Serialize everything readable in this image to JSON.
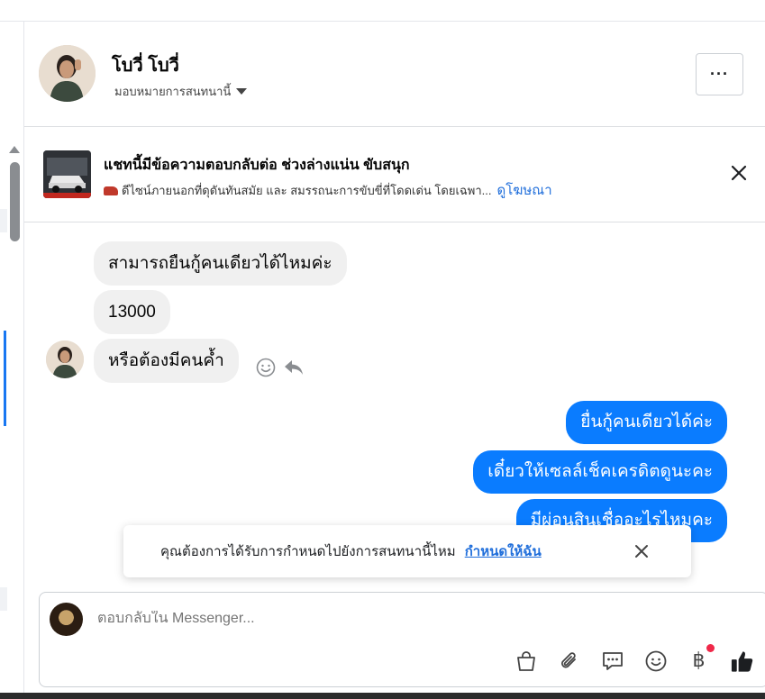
{
  "header": {
    "contact_name": "โบวี่ โบวี่",
    "assign_label": "มอบหมายการสนทนานี้",
    "more_label": "···"
  },
  "ad": {
    "title": "แชทนี้มีข้อความตอบกลับต่อ ช่วงล่างแน่น ขับสนุก",
    "subtitle": "ดีไซน์ภายนอกที่ดุดันทันสมัย และ สมรรถนะการขับขี่ที่โดดเด่น โดยเฉพา...",
    "link": "ดูโฆษณา"
  },
  "messages": {
    "incoming": [
      "สามารถยืนกู้คนเดียวได้ไหมค่ะ",
      "13000",
      "หรือต้องมีคนค้ำ"
    ],
    "outgoing": [
      "ยื่นกู้คนเดียวได้ค่ะ",
      "เดี๋ยวให้เซลล์เช็คเครดิตดูนะคะ",
      "มีผ่อนสินเชื่ออะไรไหมคะ"
    ]
  },
  "toast": {
    "text": "คุณต้องการได้รับการกำหนดไปยังการสนทนานี้ไหม",
    "action": "กำหนดให้ฉัน"
  },
  "composer": {
    "placeholder": "ตอบกลับใน Messenger...",
    "baht_symbol": "฿"
  },
  "colors": {
    "outgoing_bubble": "#0a7cff",
    "incoming_bubble": "#f0f0f0",
    "link": "#216fdb",
    "notification_dot": "#f02849"
  }
}
